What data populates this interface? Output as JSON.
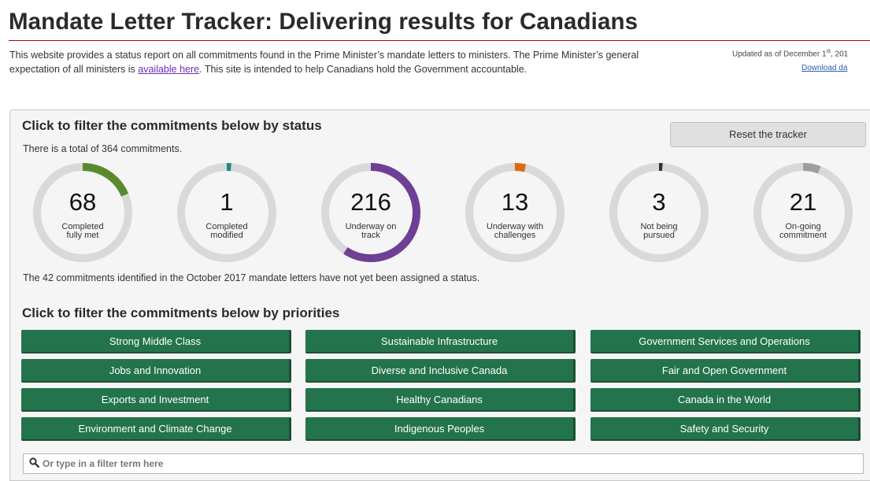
{
  "header": {
    "title": "Mandate Letter Tracker: Delivering results for Canadians",
    "intro_part1": "This website provides a status report on all commitments found in the Prime Minister’s mandate letters to ministers. The Prime Minister’s general expectation of all ministers is ",
    "intro_link": "available here",
    "intro_part2": ". This site is intended to help Canadians hold the Government accountable.",
    "updated_prefix": "Updated as of December 1",
    "updated_sup": "st",
    "updated_suffix": ", 201",
    "download_label": "Download da"
  },
  "status_section": {
    "heading": "Click to filter the commitments below by status",
    "total_text": "There is a total of 364 commitments.",
    "reset_label": "Reset the tracker",
    "note": "The 42 commitments identified in the October 2017 mandate letters have not yet been assigned a status.",
    "dials": [
      {
        "count": "68",
        "label": "Completed\nfully met",
        "fraction": 0.187,
        "color": "#5a8a2e"
      },
      {
        "count": "1",
        "label": "Completed\nmodified",
        "fraction": 0.015,
        "color": "#1a8a80"
      },
      {
        "count": "216",
        "label": "Underway on\ntrack",
        "fraction": 0.593,
        "color": "#6e3f95"
      },
      {
        "count": "13",
        "label": "Underway with\nchallenges",
        "fraction": 0.036,
        "color": "#d86a12"
      },
      {
        "count": "3",
        "label": "Not being\npursued",
        "fraction": 0.012,
        "color": "#333333"
      },
      {
        "count": "21",
        "label": "On-going\ncommitment",
        "fraction": 0.058,
        "color": "#9e9e9e"
      }
    ],
    "track_color": "#d9d9d9"
  },
  "priorities_section": {
    "heading": "Click to filter the commitments below by priorities",
    "buttons": [
      "Strong Middle Class",
      "Sustainable Infrastructure",
      "Government Services and Operations",
      "Jobs and Innovation",
      "Diverse and Inclusive Canada",
      "Fair and Open Government",
      "Exports and Investment",
      "Healthy Canadians",
      "Canada in the World",
      "Environment and Climate Change",
      "Indigenous Peoples",
      "Safety and Security"
    ],
    "button_color": "#23744c"
  },
  "search": {
    "placeholder": "Or type in a filter term here",
    "icon": "search-icon"
  }
}
